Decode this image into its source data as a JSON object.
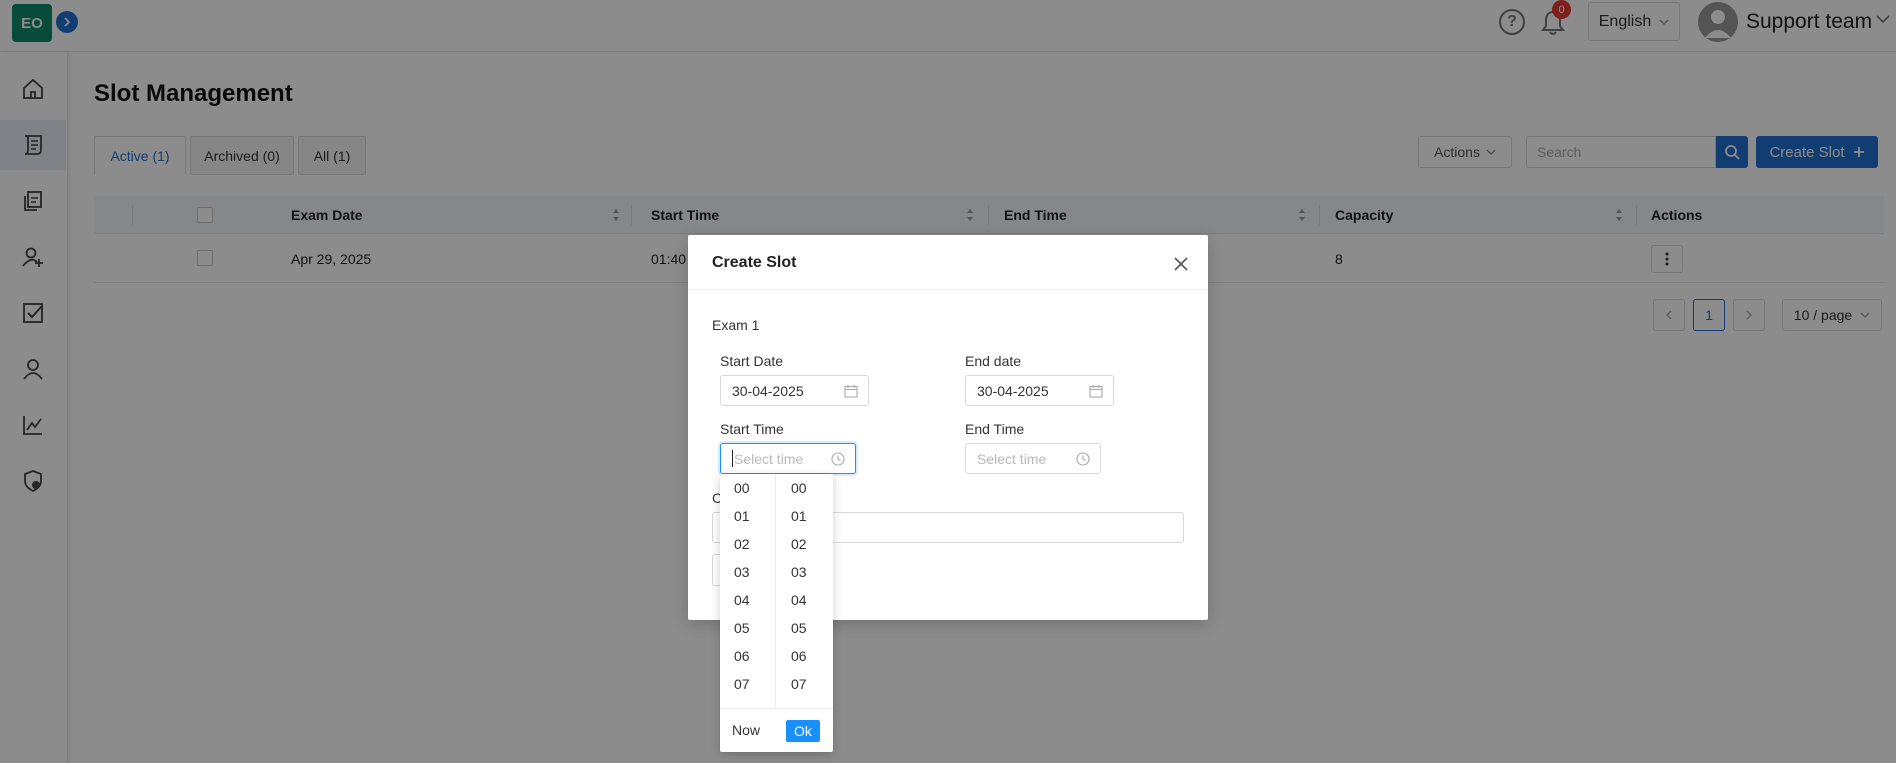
{
  "header": {
    "logo_text": "EO",
    "notification_count": "0",
    "language": "English",
    "user_name": "Support team"
  },
  "sidebar": {
    "items": [
      {
        "icon": "home-icon"
      },
      {
        "icon": "slot-scroll-icon",
        "active": true
      },
      {
        "icon": "documents-icon"
      },
      {
        "icon": "add-user-icon"
      },
      {
        "icon": "checkbox-icon"
      },
      {
        "icon": "user-icon"
      },
      {
        "icon": "chart-icon"
      },
      {
        "icon": "shield-settings-icon"
      }
    ]
  },
  "page": {
    "title": "Slot Management",
    "tabs": [
      "Active (1)",
      "Archived (0)",
      "All (1)"
    ],
    "actions_label": "Actions",
    "search_placeholder": "Search",
    "create_label": "Create Slot"
  },
  "table": {
    "columns": [
      "Exam Date",
      "Start Time",
      "End Time",
      "Capacity",
      "Actions"
    ],
    "rows": [
      {
        "exam_date": "Apr 29, 2025",
        "start_time": "01:40",
        "capacity": "8"
      }
    ]
  },
  "pagination": {
    "current": "1",
    "page_size": "10 / page"
  },
  "modal": {
    "title": "Create Slot",
    "exam_name": "Exam 1",
    "start_date_label": "Start Date",
    "start_date_value": "30-04-2025",
    "end_date_label": "End date",
    "end_date_value": "30-04-2025",
    "start_time_label": "Start Time",
    "start_time_placeholder": "Select time",
    "end_time_label": "End Time",
    "end_time_placeholder": "Select time",
    "partial_label": "C"
  },
  "time_picker": {
    "hours": [
      "00",
      "01",
      "02",
      "03",
      "04",
      "05",
      "06",
      "07"
    ],
    "minutes": [
      "00",
      "01",
      "02",
      "03",
      "04",
      "05",
      "06",
      "07"
    ],
    "now_label": "Now",
    "ok_label": "Ok"
  }
}
